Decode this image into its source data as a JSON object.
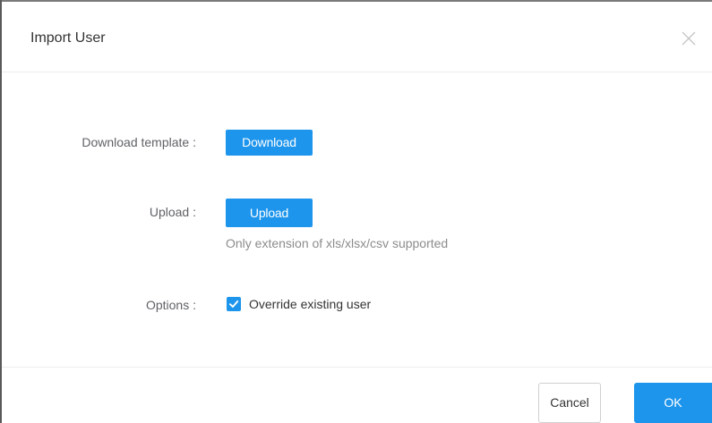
{
  "dialog": {
    "title": "Import User"
  },
  "form": {
    "download": {
      "label": "Download template :",
      "button_label": "Download"
    },
    "upload": {
      "label": "Upload :",
      "button_label": "Upload",
      "hint": "Only extension of xls/xlsx/csv supported"
    },
    "options": {
      "label": "Options :",
      "checkbox_label": "Override existing user",
      "checked": true
    }
  },
  "footer": {
    "cancel_label": "Cancel",
    "ok_label": "OK"
  },
  "icons": {
    "close": "close-icon",
    "check": "checkmark-icon"
  },
  "colors": {
    "primary": "#1e95ec",
    "title_text": "#333333",
    "label_text": "#606266",
    "hint_text": "#8c8c8c",
    "divider": "#ececec"
  }
}
